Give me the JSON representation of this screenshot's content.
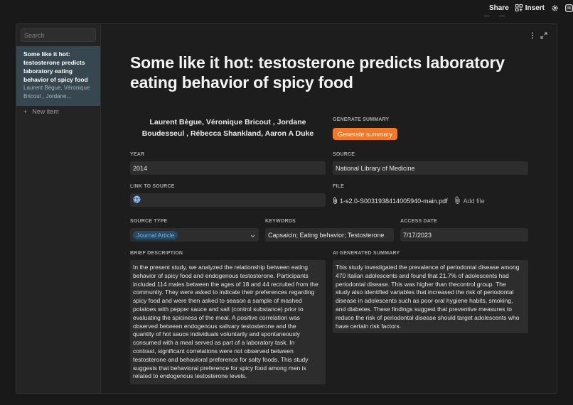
{
  "topbar": {
    "share_label": "Share",
    "insert_label": "Insert",
    "icons": [
      "grid-plus-icon",
      "gear-icon",
      "panel-icon"
    ]
  },
  "sidebar": {
    "search_placeholder": "Search",
    "items": [
      {
        "title": "Some like it hot: testosterone predicts laboratory eating behavior of spicy food",
        "subtitle_line1": "Laurent Bègue, Véronique",
        "subtitle_line2": "Bricout , Jordane..."
      }
    ],
    "new_item_label": "New item"
  },
  "page": {
    "title": "Some like it hot: testosterone predicts laboratory eating behavior of spicy food",
    "authors": "Laurent Bègue, Véronique Bricout , Jordane Boudesseul , Rébecca Shankland, Aaron A Duke"
  },
  "generate_summary": {
    "label": "GENERATE SUMMARY",
    "button_label": "Generate summary"
  },
  "fields": {
    "year": {
      "label": "YEAR",
      "value": "2014"
    },
    "source": {
      "label": "SOURCE",
      "value": "National Library of Medicine"
    },
    "link": {
      "label": "LINK TO SOURCE",
      "value": ""
    },
    "file": {
      "label": "FILE",
      "value": "1-s2.0-S0031938414005940-main.pdf",
      "add_label": "Add file"
    },
    "source_type": {
      "label": "SOURCE TYPE",
      "value": "Journal Article"
    },
    "keywords": {
      "label": "KEYWORDS",
      "value": "Capsaicin; Eating behavior; Testosterone"
    },
    "access_date": {
      "label": "ACCESS DATE",
      "value": "7/17/2023"
    },
    "brief_description": {
      "label": "BRIEF DESCRIPTION",
      "lines": [
        "In the present study, we analyzed the relationship between eating",
        "behavior of spicy food and endogenous testosterone. Participants",
        "included 114 males between the ages of 18 and 44 recruited from the",
        "community. They were asked to indicate their preferences regarding",
        "spicy food and were then asked to season a sample of mashed",
        "potatoes with pepper sauce and salt (control substance) prior to",
        "evaluating the spiciness of the meal. A positive correlation was",
        "observed between endogenous salivary testosterone and the",
        "quantity of hot sauce individuals voluntarily and spontaneously",
        "consumed with a meal served as part of a laboratory task. In",
        "contrast, significant correlations were not observed between",
        "testosterone and behavioral preference for salty foods. This study",
        "suggests that behavioral preference for spicy food among men is",
        "related to endogenous testosterone levels."
      ]
    },
    "ai_summary": {
      "label": "AI GENERATED SUMMARY",
      "lines": [
        "This study investigated the prevalence of periodontal disease among",
        "470 Italian adolescents and found that 21.7% of adolescents had",
        "periodontal disease. This was higher than thecontrol group. The",
        "study also identified variables that increased the risk of periodontal",
        "disease in adolescents such as poor oral hygiene habits, smoking,",
        "and diabetes. These findings suggest that preventive measures to",
        "reduce the risk of periodontal disease should target adolescents who",
        "have certain risk factors."
      ]
    }
  },
  "colors": {
    "accent": "#f07a2c",
    "tag_bg": "#274a66",
    "tag_text": "#6eb4e6",
    "selected_item": "#37474f"
  }
}
